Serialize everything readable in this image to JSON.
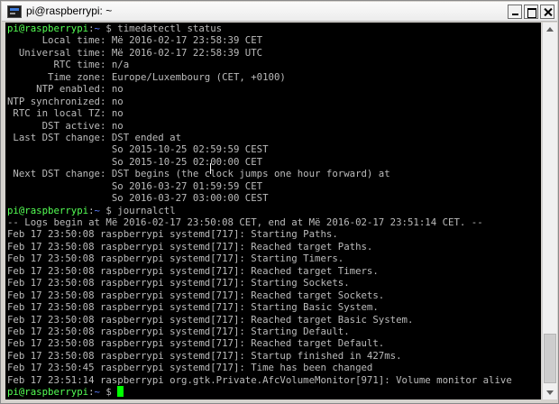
{
  "window": {
    "title": "pi@raspberrypi: ~",
    "app_icon": "terminal-icon",
    "buttons": [
      "minimize-icon",
      "maximize-icon",
      "close-icon"
    ]
  },
  "colors": {
    "terminal_bg": "#000000",
    "terminal_fg": "#bbbbbb",
    "prompt_user": "#54ff54",
    "prompt_path": "#5c7dff",
    "cursor": "#00ff00"
  },
  "terminal": {
    "prompt1": {
      "user": "pi@raspberrypi",
      "sep": ":",
      "path": "~",
      "suffix": " $ ",
      "command": "timedatectl status"
    },
    "status_lines": [
      "      Local time: Më 2016-02-17 23:58:39 CET",
      "  Universal time: Më 2016-02-17 22:58:39 UTC",
      "        RTC time: n/a",
      "       Time zone: Europe/Luxembourg (CET, +0100)",
      "     NTP enabled: no",
      "NTP synchronized: no",
      " RTC in local TZ: no",
      "      DST active: no",
      " Last DST change: DST ended at",
      "                  So 2015-10-25 02:59:59 CEST",
      "                  So 2015-10-25 02:00:00 CET",
      " Next DST change: DST begins (the clock jumps one hour forward) at",
      "                  So 2016-03-27 01:59:59 CET",
      "                  So 2016-03-27 03:00:00 CEST"
    ],
    "prompt2": {
      "user": "pi@raspberrypi",
      "sep": ":",
      "path": "~",
      "suffix": " $ ",
      "command": "journalctl"
    },
    "journal_lines": [
      "-- Logs begin at Më 2016-02-17 23:50:08 CET, end at Më 2016-02-17 23:51:14 CET. --",
      "Feb 17 23:50:08 raspberrypi systemd[717]: Starting Paths.",
      "Feb 17 23:50:08 raspberrypi systemd[717]: Reached target Paths.",
      "Feb 17 23:50:08 raspberrypi systemd[717]: Starting Timers.",
      "Feb 17 23:50:08 raspberrypi systemd[717]: Reached target Timers.",
      "Feb 17 23:50:08 raspberrypi systemd[717]: Starting Sockets.",
      "Feb 17 23:50:08 raspberrypi systemd[717]: Reached target Sockets.",
      "Feb 17 23:50:08 raspberrypi systemd[717]: Starting Basic System.",
      "Feb 17 23:50:08 raspberrypi systemd[717]: Reached target Basic System.",
      "Feb 17 23:50:08 raspberrypi systemd[717]: Starting Default.",
      "Feb 17 23:50:08 raspberrypi systemd[717]: Reached target Default.",
      "Feb 17 23:50:08 raspberrypi systemd[717]: Startup finished in 427ms.",
      "Feb 17 23:50:45 raspberrypi systemd[717]: Time has been changed",
      "Feb 17 23:51:14 raspberrypi org.gtk.Private.AfcVolumeMonitor[971]: Volume monitor alive"
    ],
    "prompt3": {
      "user": "pi@raspberrypi",
      "sep": ":",
      "path": "~",
      "suffix": " $ ",
      "command": ""
    }
  },
  "scrollbar": {
    "up_icon": "arrow-up-icon",
    "down_icon": "arrow-down-icon",
    "position": 0.9
  }
}
